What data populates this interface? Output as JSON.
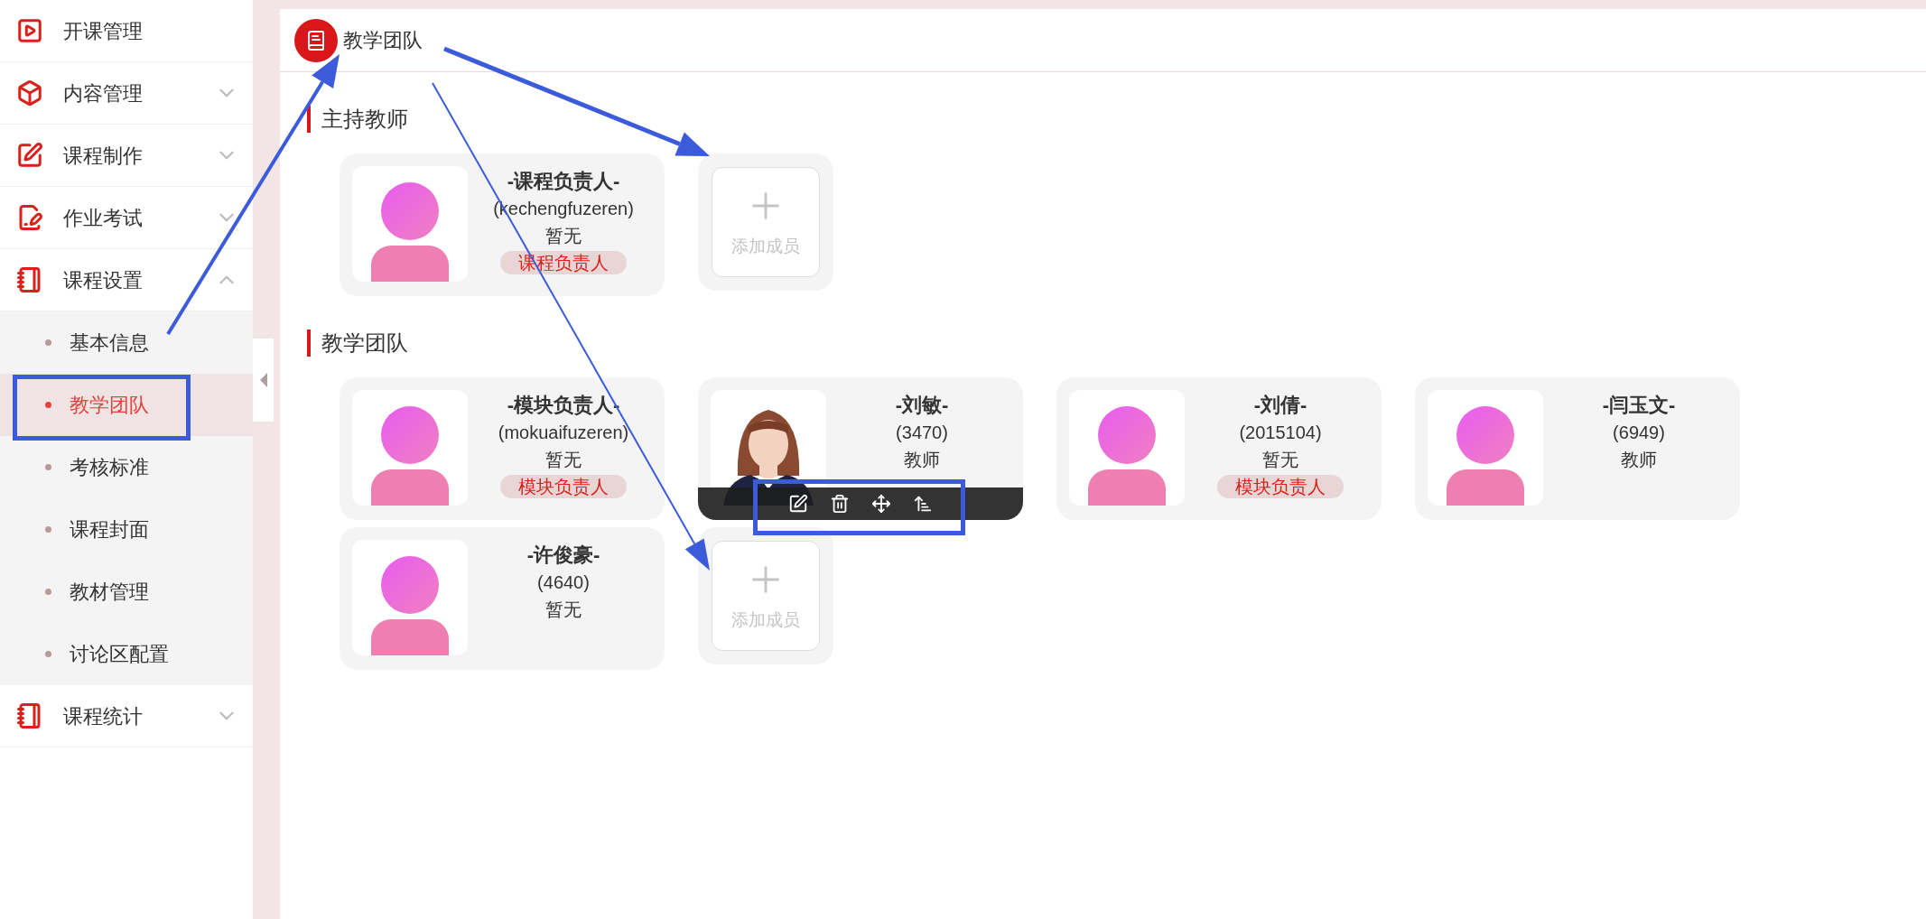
{
  "sidebar": {
    "items": [
      {
        "label": "开课管理"
      },
      {
        "label": "内容管理",
        "expanded": false
      },
      {
        "label": "课程制作",
        "expanded": false
      },
      {
        "label": "作业考试",
        "expanded": false
      },
      {
        "label": "课程设置",
        "expanded": true,
        "children": [
          {
            "label": "基本信息",
            "selected": false
          },
          {
            "label": "教学团队",
            "selected": true
          },
          {
            "label": "考核标准",
            "selected": false
          },
          {
            "label": "课程封面",
            "selected": false
          },
          {
            "label": "教材管理",
            "selected": false
          },
          {
            "label": "讨论区配置",
            "selected": false
          }
        ]
      },
      {
        "label": "课程统计",
        "expanded": false
      }
    ]
  },
  "header": {
    "title": "教学团队"
  },
  "sections": [
    {
      "title": "主持教师",
      "add_label": "添加成员",
      "members": [
        {
          "name": "-课程负责人-",
          "id": "(kechengfuzeren)",
          "role": "暂无",
          "badge": "课程负责人",
          "avatar": {
            "kind": "placeholder"
          },
          "toolbar_shown": false
        }
      ]
    },
    {
      "title": "教学团队",
      "add_label": "添加成员",
      "members": [
        {
          "name": "-模块负责人-",
          "id": "(mokuaifuzeren)",
          "role": "暂无",
          "badge": "模块负责人",
          "avatar": {
            "kind": "placeholder"
          },
          "toolbar_shown": false
        },
        {
          "name": "-刘敏-",
          "id": "(3470)",
          "role": "教师",
          "toolbar_shown": true
        },
        {
          "name": "-刘倩-",
          "id": "(2015104)",
          "role": "暂无",
          "badge": "模块负责人",
          "avatar": {
            "kind": "placeholder"
          },
          "toolbar_shown": false
        },
        {
          "name": "-闫玉文-",
          "id": "(6949)",
          "role": "教师",
          "avatar": {
            "kind": "placeholder"
          },
          "toolbar_shown": false
        },
        {
          "name": "-许俊豪-",
          "id": "(4640)",
          "role": "暂无",
          "avatar": {
            "kind": "placeholder"
          },
          "toolbar_shown": false
        }
      ]
    }
  ]
}
